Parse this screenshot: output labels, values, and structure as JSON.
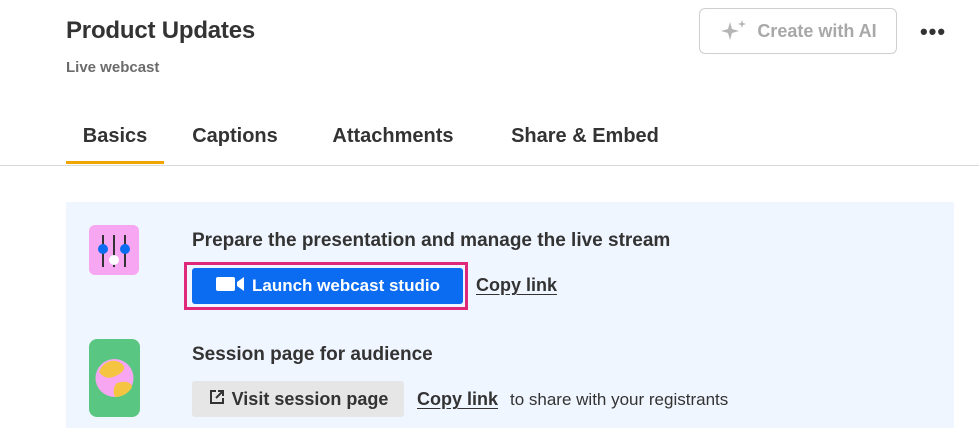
{
  "header": {
    "title": "Product Updates",
    "subtitle": "Live webcast",
    "create_ai_label": "Create with AI",
    "more_label": "•••"
  },
  "tabs": [
    {
      "label": "Basics",
      "active": true
    },
    {
      "label": "Captions",
      "active": false
    },
    {
      "label": "Attachments",
      "active": false
    },
    {
      "label": "Share & Embed",
      "active": false
    }
  ],
  "presentation": {
    "title": "Prepare the presentation and manage the live stream",
    "launch_label": "Launch webcast studio",
    "copy_link_label": "Copy link",
    "icon": "sliders-icon"
  },
  "session": {
    "title": "Session page for audience",
    "visit_label": "Visit session page",
    "copy_link_label": "Copy link",
    "share_text": "to share with your registrants",
    "icon": "session-globe-icon"
  },
  "colors": {
    "accent_blue": "#0b6cf2",
    "highlight_pink": "#e0287a",
    "tab_underline": "#f0a500",
    "panel_bg": "#f0f6ff",
    "studio_tile": "#f7a6f1",
    "session_tile": "#59c782"
  }
}
